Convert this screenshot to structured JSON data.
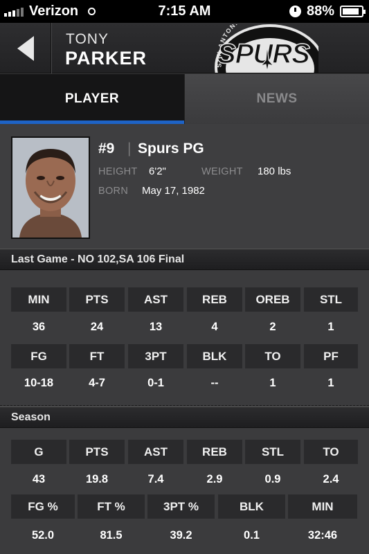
{
  "status_bar": {
    "carrier": "Verizon",
    "time": "7:15 AM",
    "battery": "88%"
  },
  "header": {
    "first_name": "TONY",
    "last_name": "PARKER",
    "logo_text": "SPURS",
    "logo_ring_text": "SAN ANTONIO"
  },
  "tabs": [
    {
      "label": "PLAYER",
      "active": true
    },
    {
      "label": "NEWS",
      "active": false
    }
  ],
  "profile": {
    "number": "#9",
    "team_position": "Spurs PG",
    "height_label": "HEIGHT",
    "height": "6'2\"",
    "weight_label": "WEIGHT",
    "weight": "180 lbs",
    "born_label": "BORN",
    "born": "May 17, 1982"
  },
  "last_game": {
    "title": "Last Game - NO 102,SA 106 Final",
    "row1_headers": [
      "MIN",
      "PTS",
      "AST",
      "REB",
      "OREB",
      "STL"
    ],
    "row1_values": [
      "36",
      "24",
      "13",
      "4",
      "2",
      "1"
    ],
    "row2_headers": [
      "FG",
      "FT",
      "3PT",
      "BLK",
      "TO",
      "PF"
    ],
    "row2_values": [
      "10-18",
      "4-7",
      "0-1",
      "--",
      "1",
      "1"
    ]
  },
  "season": {
    "title": "Season",
    "row1_headers": [
      "G",
      "PTS",
      "AST",
      "REB",
      "STL",
      "TO"
    ],
    "row1_values": [
      "43",
      "19.8",
      "7.4",
      "2.9",
      "0.9",
      "2.4"
    ],
    "row2_headers": [
      "FG %",
      "FT %",
      "3PT %",
      "BLK",
      "MIN"
    ],
    "row2_values": [
      "52.0",
      "81.5",
      "39.2",
      "0.1",
      "32:46"
    ]
  },
  "colors": {
    "accent": "#1e63c6",
    "background": "#3a3a3c",
    "cell": "#2a2a2c"
  }
}
